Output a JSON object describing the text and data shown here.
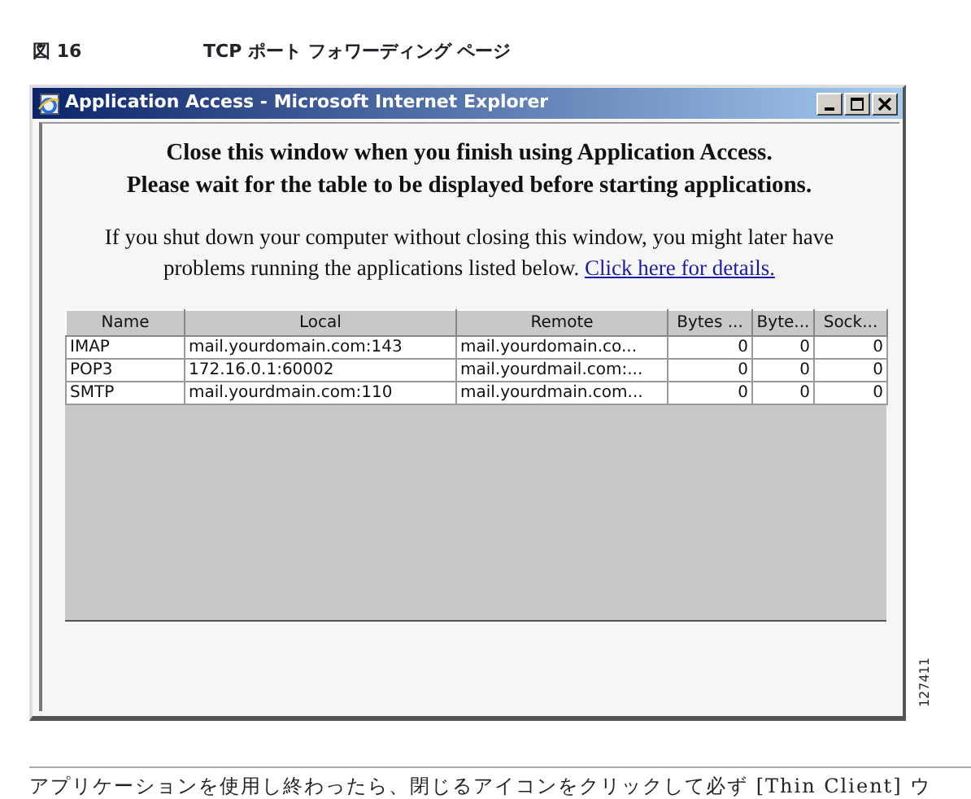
{
  "figure": {
    "number": "図 16",
    "caption": "TCP ポート フォワーディング ページ",
    "side_id": "127411"
  },
  "window": {
    "title": "Application Access - Microsoft Internet Explorer"
  },
  "notice": {
    "lines": [
      "Close this window when you finish using Application Access.",
      "Please wait for the table to be displayed before starting applications."
    ],
    "warning": "If you shut down your computer without closing this window, you might later have problems running the applications listed below.",
    "link": "Click here for details."
  },
  "table": {
    "columns": [
      {
        "label": "Name",
        "kind": "text"
      },
      {
        "label": "Local",
        "kind": "text"
      },
      {
        "label": "Remote",
        "kind": "text"
      },
      {
        "label": "Bytes ...",
        "kind": "count"
      },
      {
        "label": "Byte...",
        "kind": "count"
      },
      {
        "label": "Sock...",
        "kind": "count"
      }
    ],
    "rows": [
      [
        "IMAP",
        "mail.yourdomain.com:143",
        "mail.yourdomain.co...",
        "0",
        "0",
        "0"
      ],
      [
        "POP3",
        "172.16.0.1:60002",
        "mail.yourdmail.com:...",
        "0",
        "0",
        "0"
      ],
      [
        "SMTP",
        "mail.yourdmain.com:110",
        "mail.yourdmain.com...",
        "0",
        "0",
        "0"
      ]
    ]
  },
  "body_text": "アプリケーションを使用し終わったら、閉じるアイコンをクリックして必ず [Thin Client] ウ"
}
